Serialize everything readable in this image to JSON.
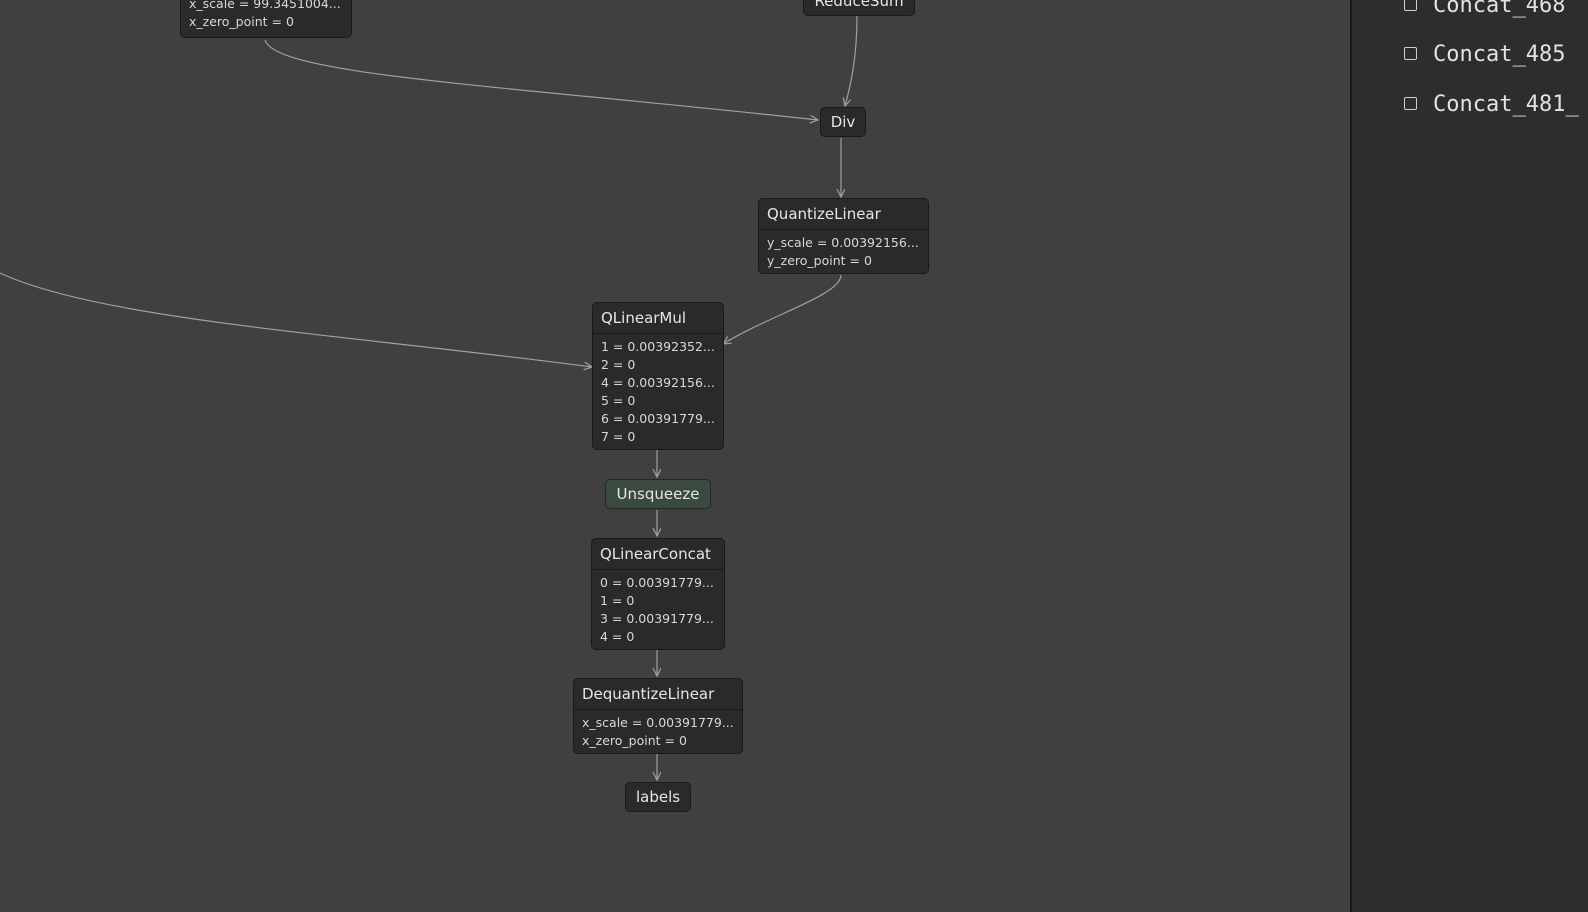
{
  "graph": {
    "top_node": {
      "attrs": [
        "x_scale = 99.3451004...",
        "x_zero_point = 0"
      ]
    },
    "reduce_sum": {
      "label": "ReduceSum"
    },
    "div": {
      "label": "Div"
    },
    "quantize_linear": {
      "title": "QuantizeLinear",
      "attrs": [
        "y_scale = 0.00392156...",
        "y_zero_point = 0"
      ]
    },
    "qlinear_mul": {
      "title": "QLinearMul",
      "attrs": [
        "1 = 0.00392352...",
        "2 = 0",
        "4 = 0.00392156...",
        "5 = 0",
        "6 = 0.00391779...",
        "7 = 0"
      ]
    },
    "unsqueeze": {
      "label": "Unsqueeze"
    },
    "qlinear_concat": {
      "title": "QLinearConcat",
      "attrs": [
        "0 = 0.00391779...",
        "1 = 0",
        "3 = 0.00391779...",
        "4 = 0"
      ]
    },
    "dequantize_linear": {
      "title": "DequantizeLinear",
      "attrs": [
        "x_scale = 0.00391779...",
        "x_zero_point = 0"
      ]
    },
    "labels": {
      "label": "labels"
    }
  },
  "sidebar": {
    "items": [
      {
        "label": "Concat_468"
      },
      {
        "label": "Concat_485"
      },
      {
        "label": "Concat_481_"
      }
    ]
  },
  "colors": {
    "canvas": "#404040",
    "node_bg": "#2a2a2a",
    "unsqueeze_bg": "#3a4a40",
    "sidebar_bg": "#2d2d2d",
    "edge": "#a0a0a0"
  }
}
